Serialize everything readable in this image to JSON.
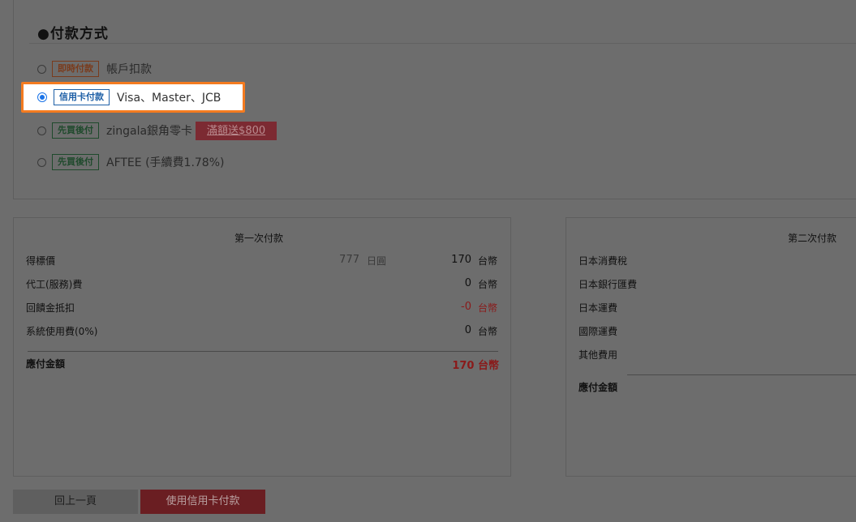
{
  "payment": {
    "title": "●付款方式",
    "options": [
      {
        "badge": "即時付款",
        "text": "帳戶扣款"
      },
      {
        "badge": "信用卡付款",
        "text": "Visa、Master、JCB"
      },
      {
        "badge": "先買後付",
        "text": "zingala銀角零卡",
        "promo": "滿額送$800"
      },
      {
        "badge": "先買後付",
        "text": "AFTEE (手續費1.78%)"
      }
    ]
  },
  "first_payment": {
    "title": "第一次付款",
    "rows": [
      {
        "label": "得標價",
        "jpy_value": "777",
        "jpy_unit": "日圓",
        "value": "170",
        "unit": "台幣"
      },
      {
        "label": "代工(服務)費",
        "value": "0",
        "unit": "台幣"
      },
      {
        "label": "回饋金抵扣",
        "value": "-0",
        "unit": "台幣"
      },
      {
        "label": "系統使用費(0%)",
        "value": "0",
        "unit": "台幣"
      }
    ],
    "total_label": "應付金額",
    "total_value": "170 台幣"
  },
  "second_payment": {
    "title": "第二次付款",
    "rows": [
      "日本消費稅",
      "日本銀行匯費",
      "日本運費",
      "國際運費",
      "其他費用"
    ],
    "total_label": "應付金額"
  },
  "buttons": {
    "back": "回上一頁",
    "pay": "使用信用卡付款"
  },
  "colors": {
    "overlay": "#6d6d6d",
    "highlight_border": "#f47b20",
    "radio_selected": "#1a73e8"
  }
}
